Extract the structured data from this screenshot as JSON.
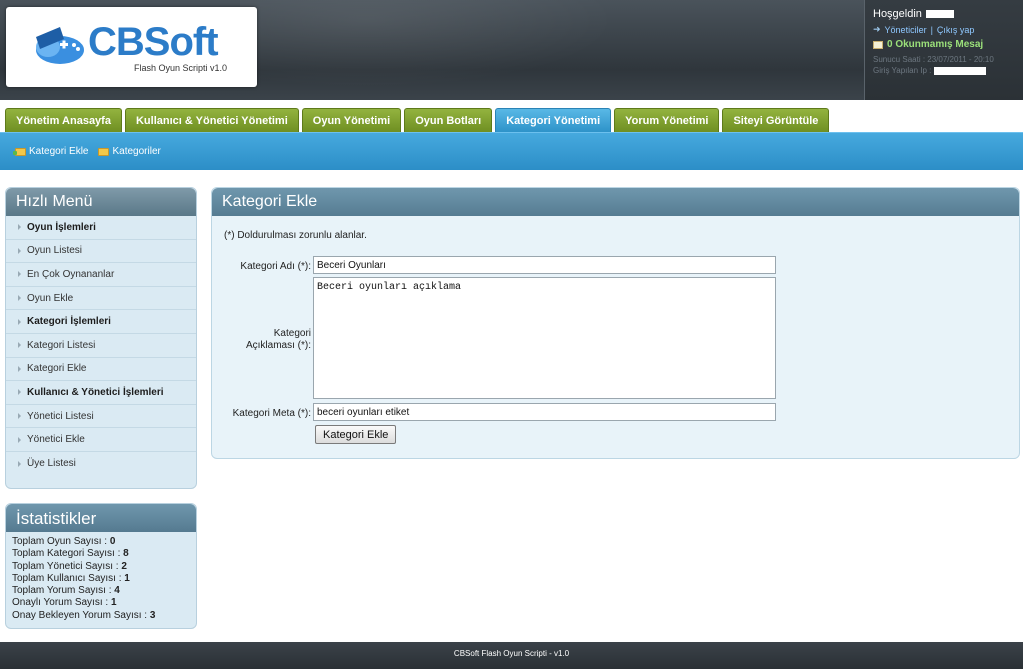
{
  "brand": {
    "name": "CBSoft",
    "subtitle": "Flash Oyun Scripti v1.0"
  },
  "user_panel": {
    "welcome": "Hoşgeldin",
    "admins_link": "Yöneticiler",
    "separator": "|",
    "logout_link": "Çıkış yap",
    "messages": "0 Okunmamış Mesaj",
    "server_time": "Sunucu Saati : 23/07/2011 - 20:10",
    "login_ip_label": "Giriş Yapılan Ip :"
  },
  "tabs": [
    {
      "label": "Yönetim Anasayfa"
    },
    {
      "label": "Kullanıcı & Yönetici Yönetimi"
    },
    {
      "label": "Oyun Yönetimi"
    },
    {
      "label": "Oyun Botları"
    },
    {
      "label": "Kategori Yönetimi"
    },
    {
      "label": "Yorum Yönetimi"
    },
    {
      "label": "Siteyi Görüntüle"
    }
  ],
  "active_tab": "Kategori Yönetimi",
  "subnav": [
    {
      "label": "Kategori Ekle"
    },
    {
      "label": "Kategoriler"
    }
  ],
  "quick_menu": {
    "title": "Hızlı Menü",
    "items": [
      {
        "label": "Oyun İşlemleri",
        "header": true
      },
      {
        "label": "Oyun Listesi"
      },
      {
        "label": "En Çok Oynananlar"
      },
      {
        "label": "Oyun Ekle"
      },
      {
        "label": "Kategori İşlemleri",
        "header": true
      },
      {
        "label": "Kategori Listesi"
      },
      {
        "label": "Kategori Ekle"
      },
      {
        "label": "Kullanıcı & Yönetici İşlemleri",
        "header": true
      },
      {
        "label": "Yönetici Listesi"
      },
      {
        "label": "Yönetici Ekle"
      },
      {
        "label": "Üye Listesi"
      }
    ]
  },
  "stats": {
    "title": "İstatistikler",
    "rows": [
      {
        "label": "Toplam Oyun Sayısı :",
        "value": "0"
      },
      {
        "label": "Toplam Kategori Sayısı :",
        "value": "8"
      },
      {
        "label": "Toplam Yönetici Sayısı :",
        "value": "2"
      },
      {
        "label": "Toplam Kullanıcı Sayısı :",
        "value": "1"
      },
      {
        "label": "Toplam Yorum Sayısı :",
        "value": "4"
      },
      {
        "label": "Onaylı Yorum Sayısı :",
        "value": "1"
      },
      {
        "label": "Onay Bekleyen Yorum Sayısı :",
        "value": "3"
      }
    ]
  },
  "form": {
    "title": "Kategori Ekle",
    "required_note": "(*) Doldurulması zorunlu alanlar.",
    "name_label": "Kategori Adı (*):",
    "name_value": "Beceri Oyunları",
    "desc_label_1": "Kategori",
    "desc_label_2": "Açıklaması (*):",
    "desc_value": "Beceri oyunları açıklama",
    "meta_label": "Kategori Meta (*):",
    "meta_value": "beceri oyunları etiket",
    "submit_label": "Kategori Ekle"
  },
  "footer": "CBSoft Flash Oyun Scripti - v1.0"
}
